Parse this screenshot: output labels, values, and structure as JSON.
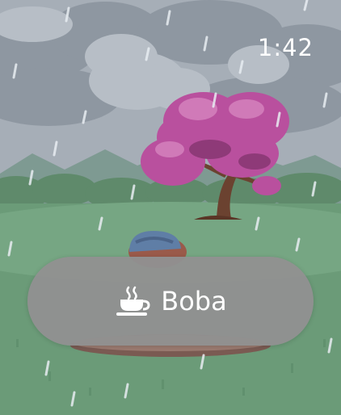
{
  "status_bar": {
    "time": "1:42"
  },
  "action_button": {
    "label": "Boba",
    "icon": "cup-icon"
  },
  "colors": {
    "sky": "#a9b1ba",
    "grass": "#6a9a78",
    "tree_blossom": "#b9509e",
    "tree_trunk": "#6b4230",
    "button_bg": "#919191",
    "text": "#ffffff"
  }
}
